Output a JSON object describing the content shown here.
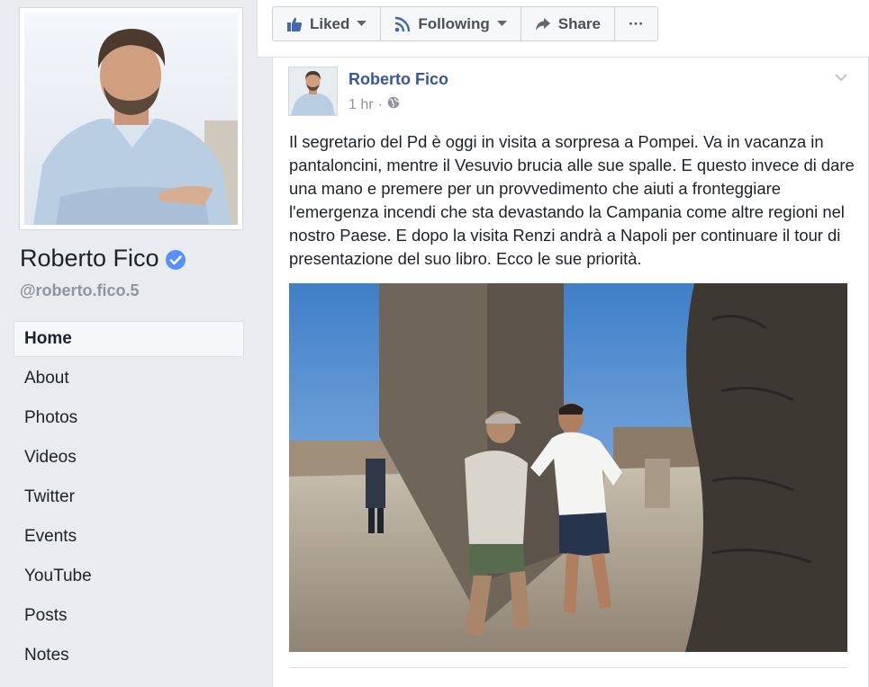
{
  "sidebar": {
    "page_name": "Roberto Fico",
    "handle": "@roberto.fico.5",
    "nav": [
      {
        "label": "Home",
        "active": true
      },
      {
        "label": "About"
      },
      {
        "label": "Photos"
      },
      {
        "label": "Videos"
      },
      {
        "label": "Twitter"
      },
      {
        "label": "Events"
      },
      {
        "label": "YouTube"
      },
      {
        "label": "Posts"
      },
      {
        "label": "Notes"
      }
    ]
  },
  "actions": {
    "liked_label": "Liked",
    "following_label": "Following",
    "share_label": "Share",
    "more_label": "···"
  },
  "post": {
    "author": "Roberto Fico",
    "time": "1 hr",
    "meta_separator": "·",
    "text": "Il segretario del Pd è oggi in visita a sorpresa a Pompei. Va in vacanza in pantaloncini, mentre il Vesuvio brucia alle sue spalle. E questo invece di dare una mano e premere per un provvedimento che aiuti a fronteggiare l'emergenza incendi che sta devastando la Campania come altre regioni nel nostro Paese. E dopo la visita Renzi andrà a Napoli per continuare il tour di presentazione del suo libro. Ecco le sue priorità."
  },
  "colors": {
    "link_blue": "#365899",
    "verified_blue": "#5890ff",
    "background": "#e9ebee",
    "muted_text": "#90949c"
  },
  "icons": {
    "verified": "verified-badge-icon",
    "liked": "thumbs-up-icon",
    "following": "rss-icon",
    "share": "share-arrow-icon",
    "privacy": "globe-icon",
    "post_menu": "chevron-down-icon"
  }
}
